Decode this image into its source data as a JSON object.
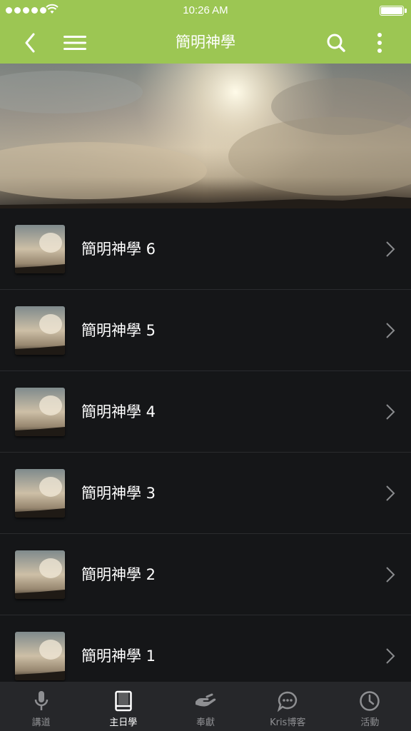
{
  "status_bar": {
    "time": "10:26 AM"
  },
  "header": {
    "title": "簡明神學",
    "back_icon": "chevron-left-icon",
    "menu_icon": "hamburger-menu-icon",
    "search_icon": "search-icon",
    "more_icon": "vertical-ellipsis-icon"
  },
  "list": {
    "items": [
      {
        "title": "簡明神學 6"
      },
      {
        "title": "簡明神學 5"
      },
      {
        "title": "簡明神學 4"
      },
      {
        "title": "簡明神學 3"
      },
      {
        "title": "簡明神學 2"
      },
      {
        "title": "簡明神學 1"
      }
    ]
  },
  "tabs": [
    {
      "label": "講道",
      "icon": "microphone-icon",
      "active": false
    },
    {
      "label": "主日學",
      "icon": "book-icon",
      "active": true
    },
    {
      "label": "奉獻",
      "icon": "offering-hand-icon",
      "active": false
    },
    {
      "label": "Kris博客",
      "icon": "chat-bubble-icon",
      "active": false
    },
    {
      "label": "活動",
      "icon": "clock-icon",
      "active": false
    }
  ],
  "colors": {
    "header_green": "#9cc653",
    "list_background": "#151618",
    "tabbar_background": "#26272a",
    "tab_active": "#ffffff",
    "tab_inactive": "#8e8f92"
  }
}
